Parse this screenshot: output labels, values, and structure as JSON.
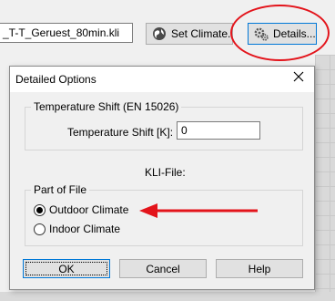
{
  "toolbar": {
    "file_name": "_T-T_Geruest_80min.kli",
    "set_climate_label": "Set Climate...",
    "details_label": "Details..."
  },
  "dialog": {
    "title": "Detailed Options",
    "temperature_group_title": "Temperature Shift (EN 15026)",
    "temperature_shift_label": "Temperature Shift [K]:",
    "temperature_shift_value": "0",
    "kli_file_label": "KLI-File:",
    "part_group_title": "Part of File",
    "options": [
      {
        "label": "Outdoor Climate",
        "checked": true
      },
      {
        "label": "Indoor Climate",
        "checked": false
      }
    ],
    "ok_label": "OK",
    "cancel_label": "Cancel",
    "help_label": "Help"
  },
  "colors": {
    "annotation": "#e3141b",
    "focus": "#0078d7",
    "button_face": "#e1e1e1"
  },
  "icons": {
    "set_climate": "globe-icon",
    "details": "gears-icon",
    "close": "close-icon"
  }
}
